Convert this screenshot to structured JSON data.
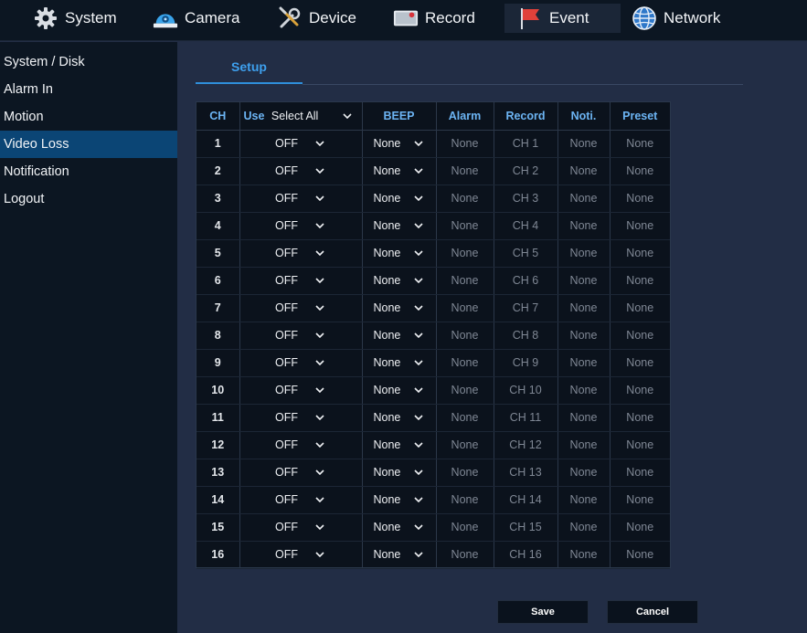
{
  "nav": {
    "system": "System",
    "camera": "Camera",
    "device": "Device",
    "record": "Record",
    "event": "Event",
    "network": "Network"
  },
  "sidebar": {
    "items": [
      {
        "label": "System / Disk"
      },
      {
        "label": "Alarm In"
      },
      {
        "label": "Motion"
      },
      {
        "label": "Video Loss"
      },
      {
        "label": "Notification"
      },
      {
        "label": "Logout"
      }
    ],
    "active_index": 3
  },
  "tab": {
    "label": "Setup"
  },
  "table": {
    "headers": {
      "ch": "CH",
      "use": "Use",
      "select_all": "Select All",
      "beep": "BEEP",
      "alarm": "Alarm",
      "record": "Record",
      "noti": "Noti.",
      "preset": "Preset"
    },
    "rows": [
      {
        "ch": "1",
        "use": "OFF",
        "beep": "None",
        "alarm": "None",
        "record": "CH 1",
        "noti": "None",
        "preset": "None"
      },
      {
        "ch": "2",
        "use": "OFF",
        "beep": "None",
        "alarm": "None",
        "record": "CH 2",
        "noti": "None",
        "preset": "None"
      },
      {
        "ch": "3",
        "use": "OFF",
        "beep": "None",
        "alarm": "None",
        "record": "CH 3",
        "noti": "None",
        "preset": "None"
      },
      {
        "ch": "4",
        "use": "OFF",
        "beep": "None",
        "alarm": "None",
        "record": "CH 4",
        "noti": "None",
        "preset": "None"
      },
      {
        "ch": "5",
        "use": "OFF",
        "beep": "None",
        "alarm": "None",
        "record": "CH 5",
        "noti": "None",
        "preset": "None"
      },
      {
        "ch": "6",
        "use": "OFF",
        "beep": "None",
        "alarm": "None",
        "record": "CH 6",
        "noti": "None",
        "preset": "None"
      },
      {
        "ch": "7",
        "use": "OFF",
        "beep": "None",
        "alarm": "None",
        "record": "CH 7",
        "noti": "None",
        "preset": "None"
      },
      {
        "ch": "8",
        "use": "OFF",
        "beep": "None",
        "alarm": "None",
        "record": "CH 8",
        "noti": "None",
        "preset": "None"
      },
      {
        "ch": "9",
        "use": "OFF",
        "beep": "None",
        "alarm": "None",
        "record": "CH 9",
        "noti": "None",
        "preset": "None"
      },
      {
        "ch": "10",
        "use": "OFF",
        "beep": "None",
        "alarm": "None",
        "record": "CH 10",
        "noti": "None",
        "preset": "None"
      },
      {
        "ch": "11",
        "use": "OFF",
        "beep": "None",
        "alarm": "None",
        "record": "CH 11",
        "noti": "None",
        "preset": "None"
      },
      {
        "ch": "12",
        "use": "OFF",
        "beep": "None",
        "alarm": "None",
        "record": "CH 12",
        "noti": "None",
        "preset": "None"
      },
      {
        "ch": "13",
        "use": "OFF",
        "beep": "None",
        "alarm": "None",
        "record": "CH 13",
        "noti": "None",
        "preset": "None"
      },
      {
        "ch": "14",
        "use": "OFF",
        "beep": "None",
        "alarm": "None",
        "record": "CH 14",
        "noti": "None",
        "preset": "None"
      },
      {
        "ch": "15",
        "use": "OFF",
        "beep": "None",
        "alarm": "None",
        "record": "CH 15",
        "noti": "None",
        "preset": "None"
      },
      {
        "ch": "16",
        "use": "OFF",
        "beep": "None",
        "alarm": "None",
        "record": "CH 16",
        "noti": "None",
        "preset": "None"
      }
    ]
  },
  "buttons": {
    "save": "Save",
    "cancel": "Cancel"
  },
  "colors": {
    "accent": "#3ea0ee",
    "header_text": "#6cb4f3",
    "sidebar_active": "#0b4575",
    "background": "#222d45",
    "panel": "#0c1622"
  },
  "icons": {
    "system": "gear-icon",
    "camera": "camera-dome-icon",
    "device": "tools-icon",
    "record": "video-record-icon",
    "event": "flag-icon",
    "network": "globe-icon",
    "dropdown": "chevron-down-icon"
  }
}
